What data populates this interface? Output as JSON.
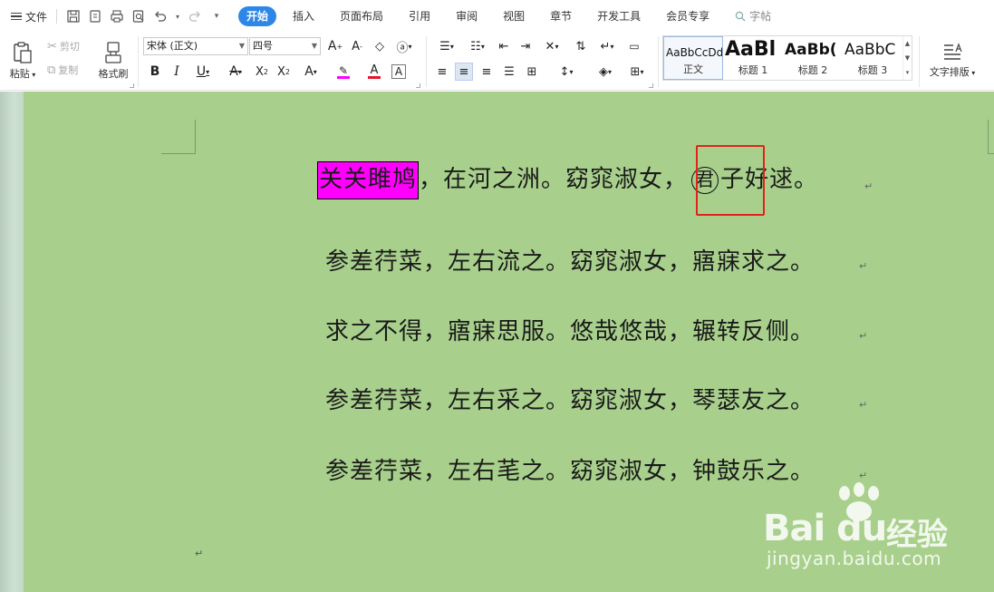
{
  "menubar": {
    "file_label": "文件",
    "tabs": [
      {
        "label": "开始",
        "active": true
      },
      {
        "label": "插入"
      },
      {
        "label": "页面布局"
      },
      {
        "label": "引用"
      },
      {
        "label": "审阅"
      },
      {
        "label": "视图"
      },
      {
        "label": "章节"
      },
      {
        "label": "开发工具"
      },
      {
        "label": "会员专享"
      }
    ],
    "search_label": "字帖"
  },
  "ribbon": {
    "paste": "粘贴",
    "cut": "剪切",
    "copy": "复制",
    "format_painter": "格式刷",
    "font_name": "宋体 (正文)",
    "font_size": "四号",
    "styles": [
      {
        "sample": "AaBbCcDd",
        "name": "正文"
      },
      {
        "sample": "AaBl",
        "name": "标题 1"
      },
      {
        "sample": "AaBb(",
        "name": "标题 2"
      },
      {
        "sample": "AaBbC",
        "name": "标题 3"
      }
    ],
    "text_layout": "文字排版",
    "colors": {
      "highlight": "#ff00ff",
      "font_color": "#e8142a",
      "active_tab": "#2e87e8"
    }
  },
  "document": {
    "background": "#a8d08c",
    "line1": {
      "highlighted": "关关雎鸠",
      "text_a": "，在河之洲。窈窕淑女，",
      "circled": "君",
      "text_b": "子好逑。"
    },
    "lines": [
      "参差荇菜，左右流之。窈窕淑女，寤寐求之。",
      "求之不得，寤寐思服。悠哉悠哉，辗转反侧。",
      "参差荇菜，左右采之。窈窕淑女，琴瑟友之。",
      "参差荇菜，左右芼之。窈窕淑女，钟鼓乐之。"
    ],
    "paragraph_mark": "↵"
  },
  "watermark": {
    "logo": "Bai du",
    "cn": "经验",
    "url": "jingyan.baidu.com"
  }
}
